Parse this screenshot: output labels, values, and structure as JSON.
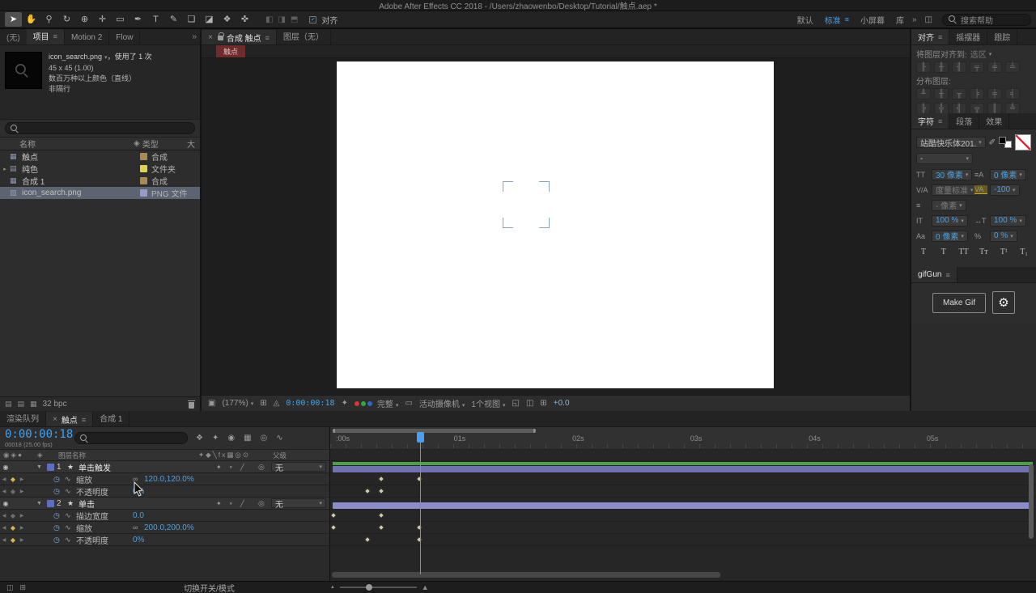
{
  "icons": {
    "menu": "≡",
    "close": "×",
    "dropdown": "▾",
    "overflow": "»",
    "check": "✓",
    "eye": "◉",
    "expand": "▼",
    "collapse": "▸",
    "star": "★",
    "stopwatch": "◷",
    "graph": "∿",
    "link": "∞",
    "kf_prev": "◀",
    "kf_next": "▶",
    "kf_diamond": "◆",
    "motion_blur": "◎",
    "comp": "▦",
    "folder": "▤",
    "footage": "▨",
    "tag": "◈",
    "monitor": "▣",
    "screen": "◫",
    "preview_quality": "▤",
    "grid": "⊞",
    "target": "◎",
    "snapshot": "✦",
    "roi": "▭",
    "pixel_aspect": "◱",
    "mask_vis": "◬",
    "gear": "⚙",
    "footer_a": "◫",
    "footer_b": "⊞",
    "mountain": "▲",
    "tt": "TT",
    "lead": "≡A",
    "kern": "V/A",
    "track": "VA",
    "stroke": "≡",
    "vscale": "IT",
    "hscale": "↔T",
    "baseline": "Aa",
    "tsume": "%"
  },
  "titlebar": {
    "title": "Adobe After Effects CC 2018 - /Users/zhaowenbo/Desktop/Tutorial/触点.aep *"
  },
  "toolbar": {
    "tools": [
      {
        "name": "selection-tool",
        "glyph": "➤",
        "active": true
      },
      {
        "name": "hand-tool",
        "glyph": "✋"
      },
      {
        "name": "zoom-tool",
        "glyph": "⚲"
      },
      {
        "name": "rotation-tool",
        "glyph": "↻"
      },
      {
        "name": "camera-tool",
        "glyph": "⊕"
      },
      {
        "name": "pan-behind-tool",
        "glyph": "✛"
      },
      {
        "name": "shape-tool",
        "glyph": "▭"
      },
      {
        "name": "pen-tool",
        "glyph": "✒"
      },
      {
        "name": "text-tool",
        "glyph": "T"
      },
      {
        "name": "brush-tool",
        "glyph": "✎"
      },
      {
        "name": "clone-stamp-tool",
        "glyph": "❏"
      },
      {
        "name": "eraser-tool",
        "glyph": "◪"
      },
      {
        "name": "roto-brush-tool",
        "glyph": "❖"
      },
      {
        "name": "puppet-pin-tool",
        "glyph": "✜"
      }
    ],
    "extra_icons": [
      "◧",
      "◨",
      "⬒"
    ],
    "snap_label": "对齐",
    "workspaces": [
      {
        "label": "默认"
      },
      {
        "label": "标准",
        "active": true,
        "menu": true
      },
      {
        "label": "小屏幕"
      },
      {
        "label": "库"
      }
    ],
    "search_placeholder": "搜索帮助"
  },
  "project_panel": {
    "corner_label": "(无)",
    "tabs": [
      {
        "label": "项目",
        "active": true,
        "menu": true
      },
      {
        "label": "Motion 2"
      },
      {
        "label": "Flow"
      }
    ],
    "preview": {
      "filename": "icon_search.png",
      "usage": "，使用了 1 次",
      "dimensions": "45 x 45 (1.00)",
      "color_info": "数百万种以上颜色（直线）",
      "interlace": "非隔行"
    },
    "columns": {
      "name": "名称",
      "type": "类型",
      "size": "大"
    },
    "items": [
      {
        "name": "触点",
        "type": "合成",
        "icon": "comp",
        "chip": "#a98a52"
      },
      {
        "name": "纯色",
        "type": "文件夹",
        "icon": "folder",
        "chip": "#ded24e",
        "expand": true
      },
      {
        "name": "合成 1",
        "type": "合成",
        "icon": "comp",
        "chip": "#a98a52"
      },
      {
        "name": "icon_search.png",
        "type": "PNG 文件",
        "icon": "footage",
        "chip": "#9a9ac6",
        "selected": true
      }
    ],
    "footer": {
      "bpc": "32 bpc"
    }
  },
  "comp_panel": {
    "tabs": [
      {
        "label": "合成 触点",
        "active": true,
        "close": true,
        "lock": true,
        "menu": true
      },
      {
        "label": "图层（无）"
      }
    ],
    "breadcrumb": "触点",
    "footer": {
      "zoom": "(177%)",
      "timecode": "0:00:00:18",
      "resolution": "完整",
      "camera": "活动摄像机",
      "views": "1个视图",
      "exposure": "+0.0"
    }
  },
  "right": {
    "align": {
      "tabs": [
        {
          "label": "对齐",
          "active": true,
          "menu": true
        },
        {
          "label": "摇摆器"
        },
        {
          "label": "跟踪"
        }
      ],
      "to_label": "将图层对齐到:",
      "to_value": "选区",
      "align_buttons": [
        "╟",
        "╫",
        "╢",
        "╤",
        "╪",
        "╧"
      ],
      "distribute_label": "分布图层:",
      "distribute_row1": [
        "╨",
        "╫",
        "╥",
        "╞",
        "╪",
        "╡"
      ],
      "distribute_row2": [
        "╠",
        "╬",
        "╣",
        "╦",
        "║",
        "╩"
      ]
    },
    "character": {
      "tabs": [
        {
          "label": "字符",
          "active": true,
          "menu": true
        },
        {
          "label": "段落"
        },
        {
          "label": "效果"
        }
      ],
      "font_name": "站酷快乐体201...",
      "font_style": "-",
      "font_size": "30 像素",
      "leading": "0 像素",
      "kerning": "度量标准",
      "tracking": "-100",
      "stroke_width": "- 像素",
      "vertical_scale": "100 %",
      "horizontal_scale": "100 %",
      "baseline_shift": "0 像素",
      "tsume": "0 %",
      "style_buttons": [
        "T",
        "T",
        "TT",
        "Tᴛ",
        "T¹",
        "T₁"
      ]
    },
    "gifgun": {
      "tabs": [
        {
          "label": "gifGun",
          "active": true,
          "menu": true
        }
      ],
      "make_gif": "Make Gif"
    }
  },
  "timeline": {
    "tabs": [
      {
        "label": "渲染队列"
      },
      {
        "label": "触点",
        "active": true,
        "close": true,
        "menu": true
      },
      {
        "label": "合成 1"
      }
    ],
    "timecode": "0:00:00:18",
    "frame_info": "00018 (25.00 fps)",
    "top_icons": [
      {
        "name": "composition-mini-flowchart-icon",
        "glyph": "❖"
      },
      {
        "name": "draft-3d-icon",
        "glyph": "✦"
      },
      {
        "name": "hide-shy-layers-icon",
        "glyph": "◉"
      },
      {
        "name": "frame-blending-icon",
        "glyph": "▦"
      },
      {
        "name": "motion-blur-icon",
        "glyph": "◎"
      },
      {
        "name": "graph-editor-icon",
        "glyph": "∿"
      }
    ],
    "columns": {
      "avf": "◉◈●",
      "tag": "◈",
      "layer_name": "图层名称",
      "switches": "✦◆╲fx▦◎⊙",
      "parent": "父级"
    },
    "ruler_labels": [
      {
        "text": ":00s",
        "pct": 0.8
      },
      {
        "text": "01s",
        "pct": 17.5
      },
      {
        "text": "02s",
        "pct": 34.3
      },
      {
        "text": "03s",
        "pct": 51.0
      },
      {
        "text": "04s",
        "pct": 67.8
      },
      {
        "text": "05s",
        "pct": 84.5
      }
    ],
    "playhead_pct": 12.7,
    "work_area": {
      "start_pct": 0.3,
      "end_pct": 29.1
    },
    "layers": [
      {
        "index": "1",
        "name": "单击触发",
        "switches": "✦ ⚬ ╱",
        "parent": "无",
        "chip": "#5f6fc0",
        "bar": {
          "color": "#6f71b0",
          "top_color": "#4ba244"
        },
        "properties": [
          {
            "name": "缩放",
            "value": "120.0,120.0%",
            "linked": true,
            "keyframes_pct": [
              7.3,
              12.7
            ]
          },
          {
            "name": "不透明度",
            "value": "0%",
            "keyframes_pct": [
              5.4,
              7.3
            ]
          }
        ]
      },
      {
        "index": "2",
        "name": "单击",
        "switches": "✦ ⚬ ╱",
        "parent": "无",
        "chip": "#5f6fc0",
        "bar": {
          "color": "#8b8dcb"
        },
        "properties": [
          {
            "name": "描边宽度",
            "value": "0.0",
            "keyframes_pct": [
              0.6,
              7.3
            ]
          },
          {
            "name": "缩放",
            "value": "200.0,200.0%",
            "linked": true,
            "keyframes_pct": [
              0.6,
              7.3,
              12.7
            ]
          },
          {
            "name": "不透明度",
            "value": "0%",
            "keyframes_pct": [
              5.4,
              12.7
            ]
          }
        ]
      }
    ],
    "toggle_modes_label": "切换开关/模式"
  }
}
